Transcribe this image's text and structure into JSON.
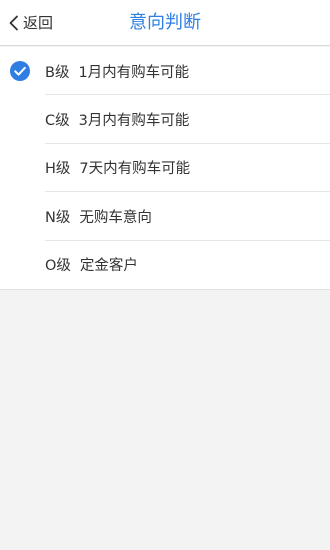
{
  "header": {
    "back_label": "返回",
    "title": "意向判断"
  },
  "colors": {
    "accent": "#2f7fe3",
    "background": "#f3f3f3"
  },
  "options": [
    {
      "level": "B级",
      "desc": "1月内有购车可能",
      "selected": true
    },
    {
      "level": "C级",
      "desc": "3月内有购车可能",
      "selected": false
    },
    {
      "level": "H级",
      "desc": "7天内有购车可能",
      "selected": false
    },
    {
      "level": "N级",
      "desc": "无购车意向",
      "selected": false
    },
    {
      "level": "O级",
      "desc": "定金客户",
      "selected": false
    }
  ],
  "icons": {
    "back": "chevron-left-icon",
    "selected": "checkmark-circle-icon"
  }
}
